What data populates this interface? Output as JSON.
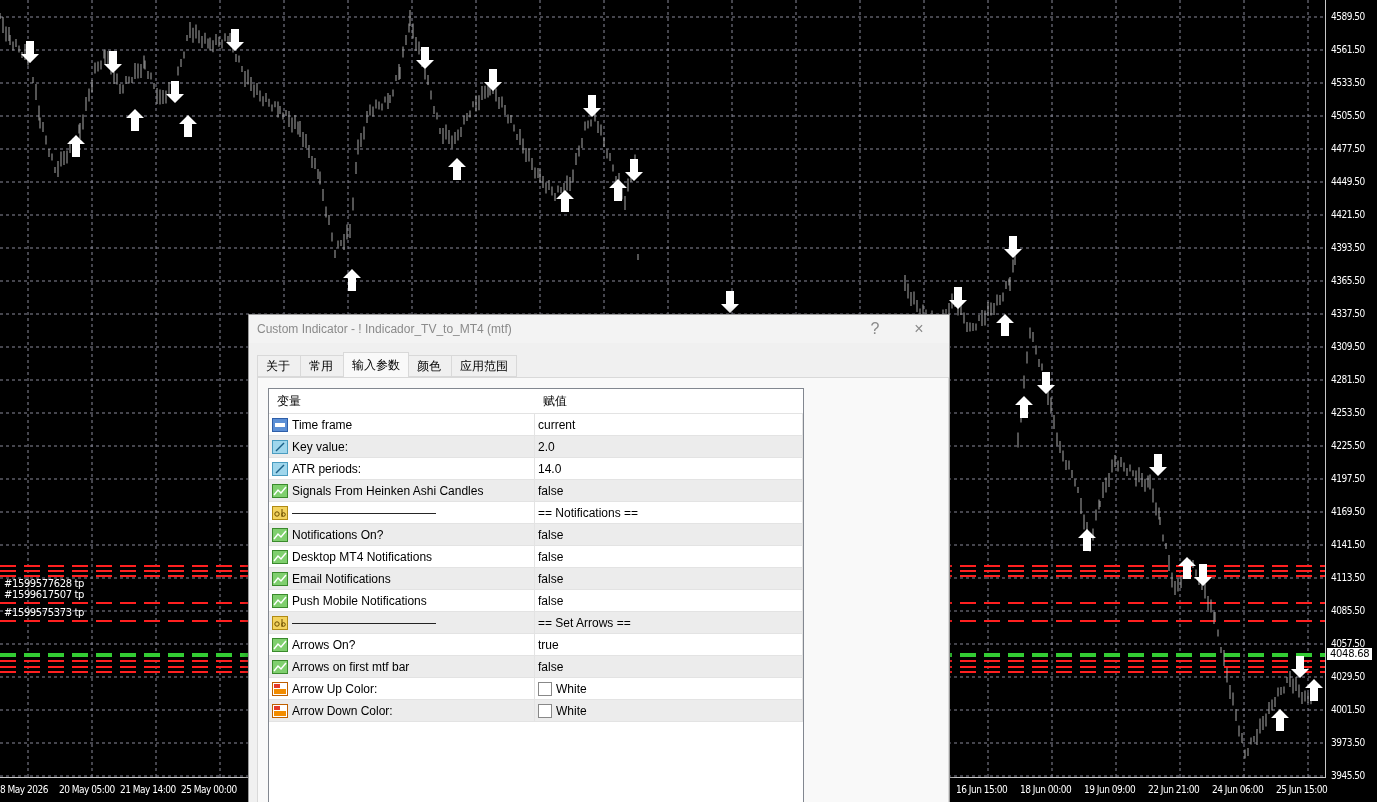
{
  "chart": {
    "price_ticks": [
      "4589.50",
      "4561.50",
      "4533.50",
      "4505.50",
      "4477.50",
      "4449.50",
      "4421.50",
      "4393.50",
      "4365.50",
      "4337.50",
      "4309.50",
      "4281.50",
      "4253.50",
      "4225.50",
      "4197.50",
      "4169.50",
      "4141.50",
      "4113.50",
      "4085.50",
      "4057.50",
      "4029.50",
      "4001.50",
      "3973.50",
      "3945.50"
    ],
    "current_price": "4048.68",
    "time_ticks": [
      "8 May 2026",
      "20 May 05:00",
      "21 May 14:00",
      "25 May 00:00",
      "16 Jun 15:00",
      "18 Jun 00:00",
      "19 Jun 09:00",
      "22 Jun 21:00",
      "24 Jun 06:00",
      "25 Jun 15:00"
    ],
    "order_labels": [
      "#1599577628 tp",
      "#1599617507 tp",
      "#1599575373 tp"
    ]
  },
  "dialog": {
    "title": "Custom Indicator - ! Indicador_TV_to_MT4 (mtf)",
    "help": "?",
    "close": "×",
    "tabs": [
      {
        "label": "关于",
        "selected": false
      },
      {
        "label": "常用",
        "selected": false
      },
      {
        "label": "输入参数",
        "selected": true
      },
      {
        "label": "颜色",
        "selected": false
      },
      {
        "label": "应用范围",
        "selected": false
      }
    ],
    "columns": [
      "变量",
      "赋值"
    ],
    "rows": [
      {
        "kind": "int",
        "name": "Time frame",
        "value": "current"
      },
      {
        "kind": "double",
        "name": "Key value:",
        "value": "2.0"
      },
      {
        "kind": "double",
        "name": "ATR periods:",
        "value": "14.0"
      },
      {
        "kind": "bool",
        "name": "Signals From Heinken Ashi Candles",
        "value": "false"
      },
      {
        "kind": "string",
        "name": "————————————",
        "value": "== Notifications =="
      },
      {
        "kind": "bool",
        "name": "Notifications On?",
        "value": "false"
      },
      {
        "kind": "bool",
        "name": "Desktop MT4 Notifications",
        "value": "false"
      },
      {
        "kind": "bool",
        "name": "Email Notifications",
        "value": "false"
      },
      {
        "kind": "bool",
        "name": "Push Mobile Notifications",
        "value": "false"
      },
      {
        "kind": "string",
        "name": "————————————",
        "value": "== Set Arrows =="
      },
      {
        "kind": "bool",
        "name": "Arrows On?",
        "value": "true"
      },
      {
        "kind": "bool",
        "name": "Arrows on first mtf bar",
        "value": "false"
      },
      {
        "kind": "color",
        "name": "Arrow Up Color:",
        "value": "White",
        "color": "#ffffff"
      },
      {
        "kind": "color",
        "name": "Arrow Down Color:",
        "value": "White",
        "color": "#ffffff"
      }
    ]
  }
}
